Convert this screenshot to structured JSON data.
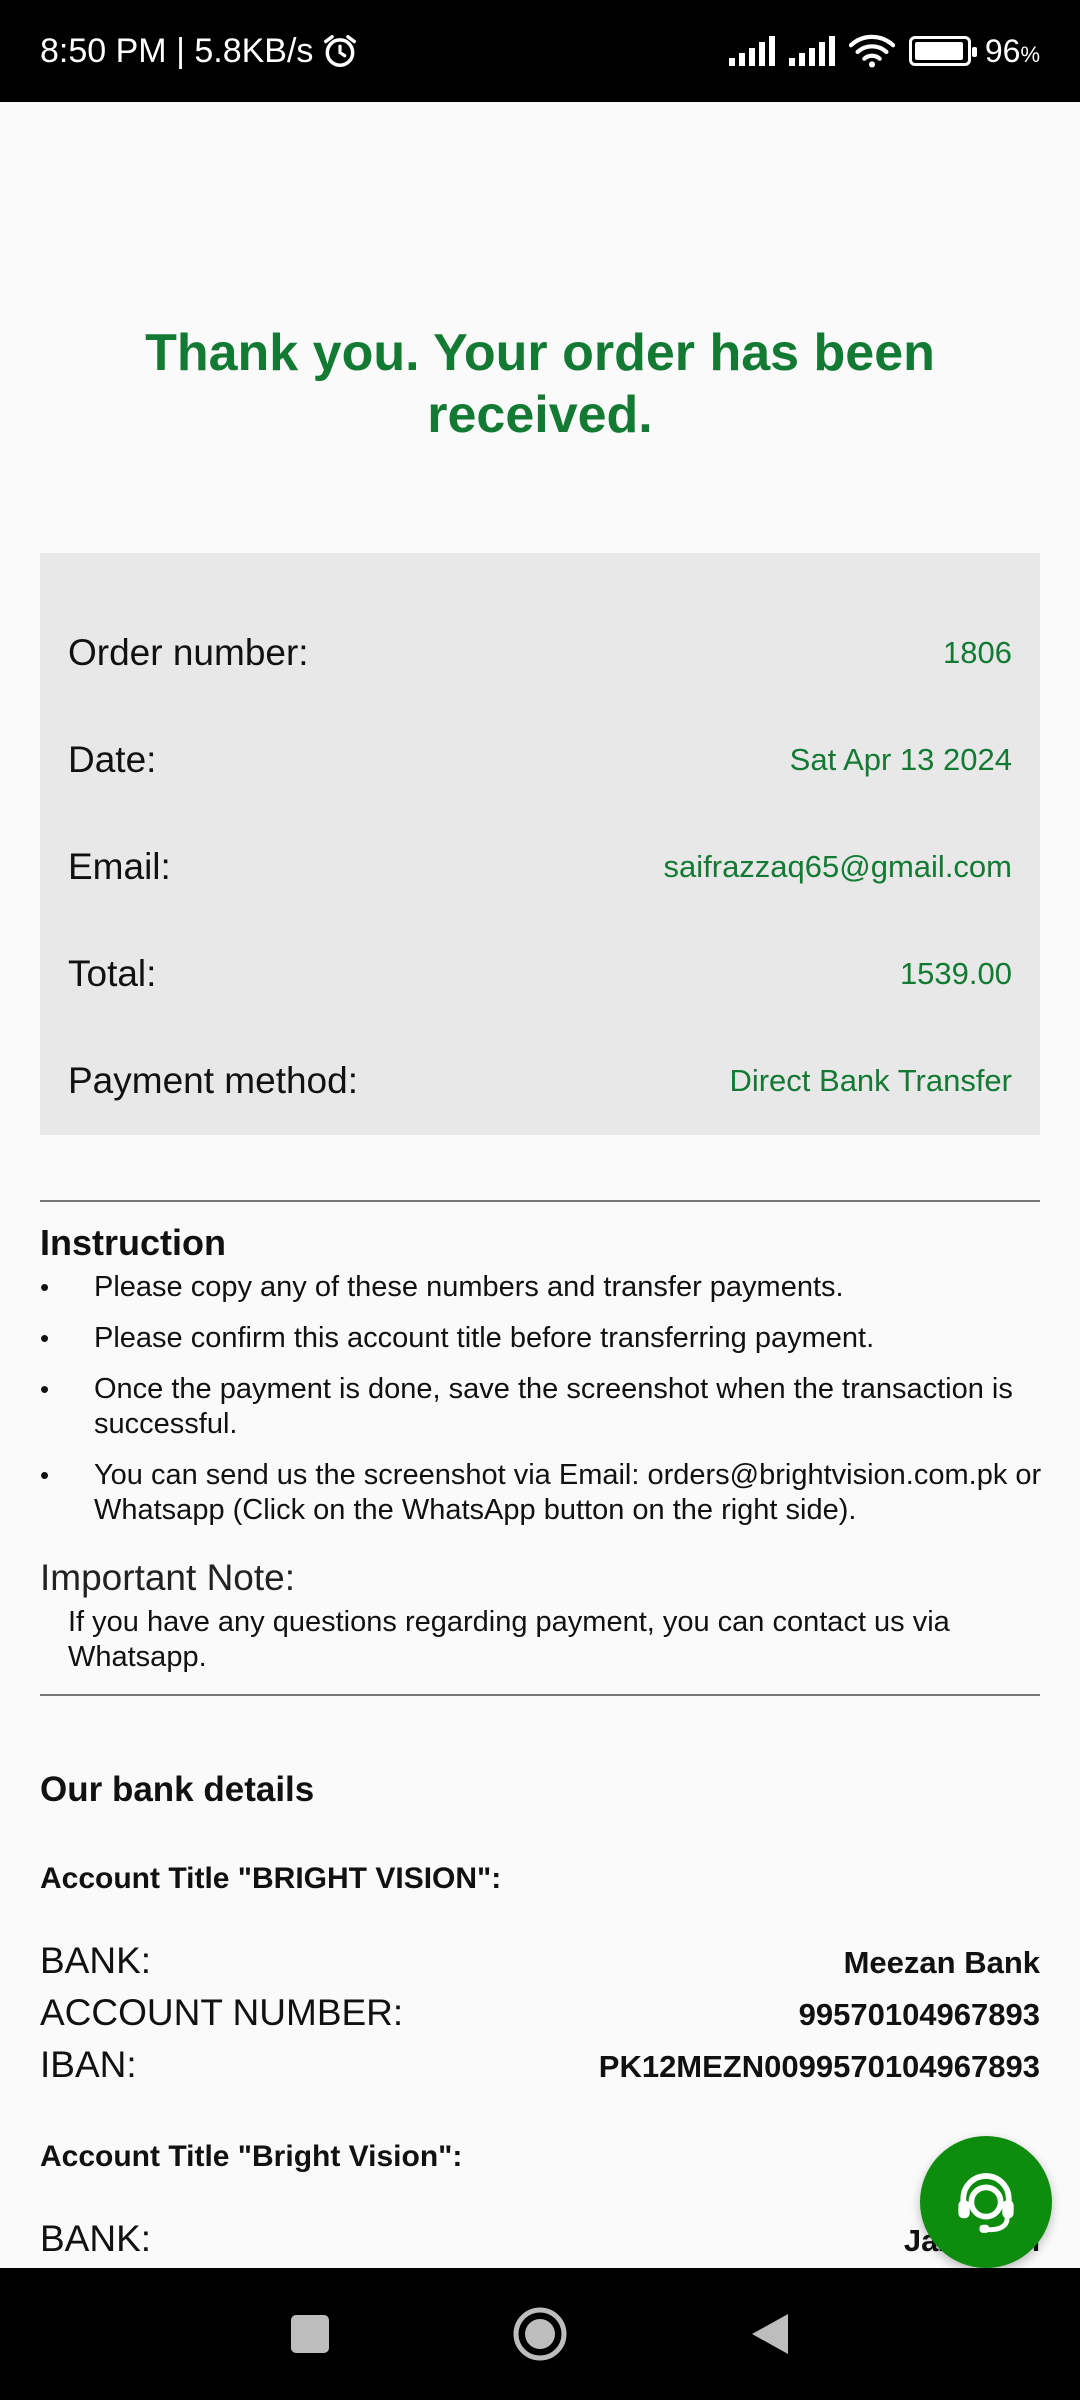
{
  "status_bar": {
    "time_speed": "8:50 PM | 5.8KB/s",
    "battery": "96",
    "battery_unit": "%",
    "battery_level": 0.96,
    "icons": [
      "alarm-icon",
      "signal-icon",
      "signal-icon",
      "wifi-icon",
      "battery-icon"
    ]
  },
  "page": {
    "thank_you": "Thank you. Your order has been received."
  },
  "order": {
    "rows": [
      {
        "label": "Order number:",
        "value": "1806"
      },
      {
        "label": "Date:",
        "value": "Sat Apr 13 2024"
      },
      {
        "label": "Email:",
        "value": "saifrazzaq65@gmail.com"
      },
      {
        "label": "Total:",
        "value": "1539.00"
      },
      {
        "label": "Payment method:",
        "value": "Direct Bank Transfer"
      }
    ]
  },
  "instructions": {
    "title": "Instruction",
    "items": [
      "Please copy any of these numbers and transfer payments.",
      "Please confirm this account title before transferring payment.",
      "Once the payment is done, save the screenshot when the transaction is successful.",
      "You can send us the screenshot via Email: orders@brightvision.com.pk or Whatsapp (Click on the WhatsApp button on the right side)."
    ]
  },
  "note": {
    "title": "Important Note:",
    "text": "If you have any questions regarding payment, you can contact us via Whatsapp."
  },
  "bank": {
    "title": "Our bank details",
    "accounts": [
      {
        "title": "Account Title \"BRIGHT VISION\":",
        "rows": [
          {
            "key": "BANK:",
            "value": "Meezan Bank"
          },
          {
            "key": "ACCOUNT NUMBER:",
            "value": "99570104967893"
          },
          {
            "key": "IBAN:",
            "value": "PK12MEZN0099570104967893"
          }
        ]
      },
      {
        "title": "Account Title \"Bright Vision\":",
        "rows": [
          {
            "key": "BANK:",
            "value": "Jazzcash"
          }
        ]
      }
    ]
  },
  "colors": {
    "accent_green": "#137a33",
    "fab_green": "#0d8c0d",
    "summary_bg": "#e8e8e8"
  },
  "fab": {
    "icon": "support-headset-icon"
  },
  "nav": {
    "icons": [
      "recents-square-icon",
      "home-circle-icon",
      "back-triangle-icon"
    ]
  }
}
